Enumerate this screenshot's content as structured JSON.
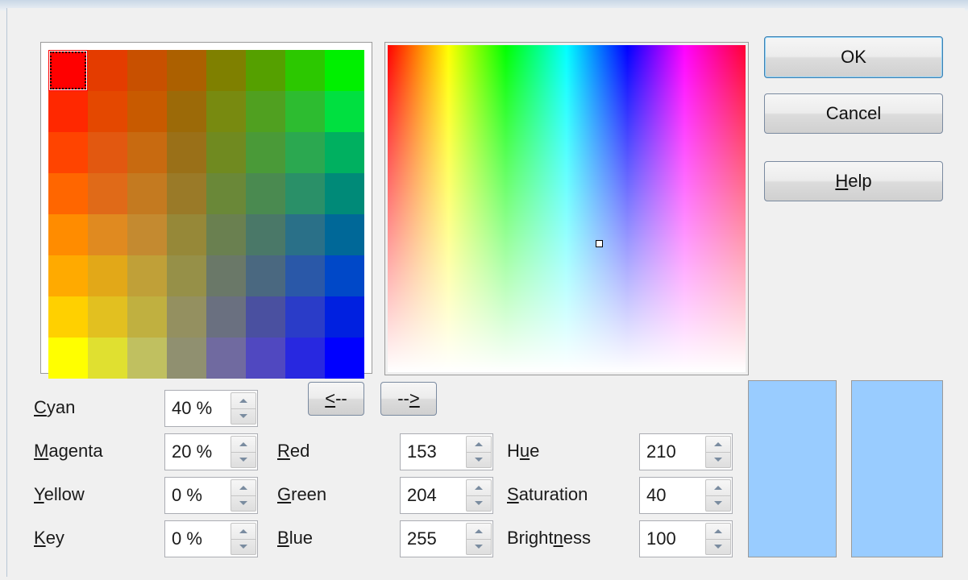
{
  "palette": {
    "selected_index": 0,
    "colors": [
      "#ff0000",
      "#e43c00",
      "#c85000",
      "#ac6000",
      "#7f8000",
      "#55a000",
      "#2cc800",
      "#00f000",
      "#ff2800",
      "#e44800",
      "#c85a00",
      "#9c6a08",
      "#788a10",
      "#50a020",
      "#2dbc30",
      "#00e040",
      "#ff4400",
      "#e25810",
      "#c86a10",
      "#9a7018",
      "#708a20",
      "#4a9a38",
      "#2ba850",
      "#00b060",
      "#ff6600",
      "#e06a18",
      "#c47a20",
      "#9a7a28",
      "#6a8838",
      "#4a8a50",
      "#2a9068",
      "#008a78",
      "#ff8c00",
      "#e08a20",
      "#c48a30",
      "#968838",
      "#6a8050",
      "#4a7868",
      "#2a7088",
      "#006898",
      "#ffaa00",
      "#e2a818",
      "#c0a038",
      "#969048",
      "#6a7868",
      "#4a6880",
      "#2a58a8",
      "#0048c8",
      "#ffd000",
      "#e2c020",
      "#c0b040",
      "#949060",
      "#6a7080",
      "#4a50a0",
      "#2a3cc8",
      "#0020e0",
      "#ffff00",
      "#e0e030",
      "#c0c060",
      "#909070",
      "#706aa0",
      "#5048c0",
      "#2828e0",
      "#0000ff"
    ]
  },
  "buttons": {
    "ok": "OK",
    "cancel": "Cancel",
    "help_key": "H",
    "help_rest": "elp",
    "left_arrow_key": "<",
    "left_arrow_rest": "--",
    "right_arrow_pre": "--",
    "right_arrow_key": ">"
  },
  "cmyk": {
    "cyan": {
      "key": "C",
      "rest": "yan",
      "value": "40 %"
    },
    "magenta": {
      "key": "M",
      "rest": "agenta",
      "value": "20 %"
    },
    "yellow": {
      "key": "Y",
      "rest": "ellow",
      "value": "0 %"
    },
    "key": {
      "key": "K",
      "rest": "ey",
      "value": "0 %"
    }
  },
  "rgb": {
    "red": {
      "key": "R",
      "rest": "ed",
      "value": "153"
    },
    "green": {
      "key": "G",
      "rest": "reen",
      "value": "204"
    },
    "blue": {
      "key": "B",
      "rest": "lue",
      "value": "255"
    }
  },
  "hsb": {
    "hue": {
      "pre": "H",
      "key": "u",
      "rest": "e",
      "value": "210"
    },
    "saturation": {
      "pre": "",
      "key": "S",
      "rest": "aturation",
      "value": "40"
    },
    "brightness": {
      "pre": "Brigh",
      "key": "t",
      "mid": "n",
      "rest": "ess",
      "value": "100",
      "pre2": "Brigh",
      "key2": "t"
    }
  },
  "preview": {
    "original_color": "#99ccff",
    "new_color": "#99ccff"
  },
  "icons": {
    "spin": "spin-arrows-icon"
  }
}
